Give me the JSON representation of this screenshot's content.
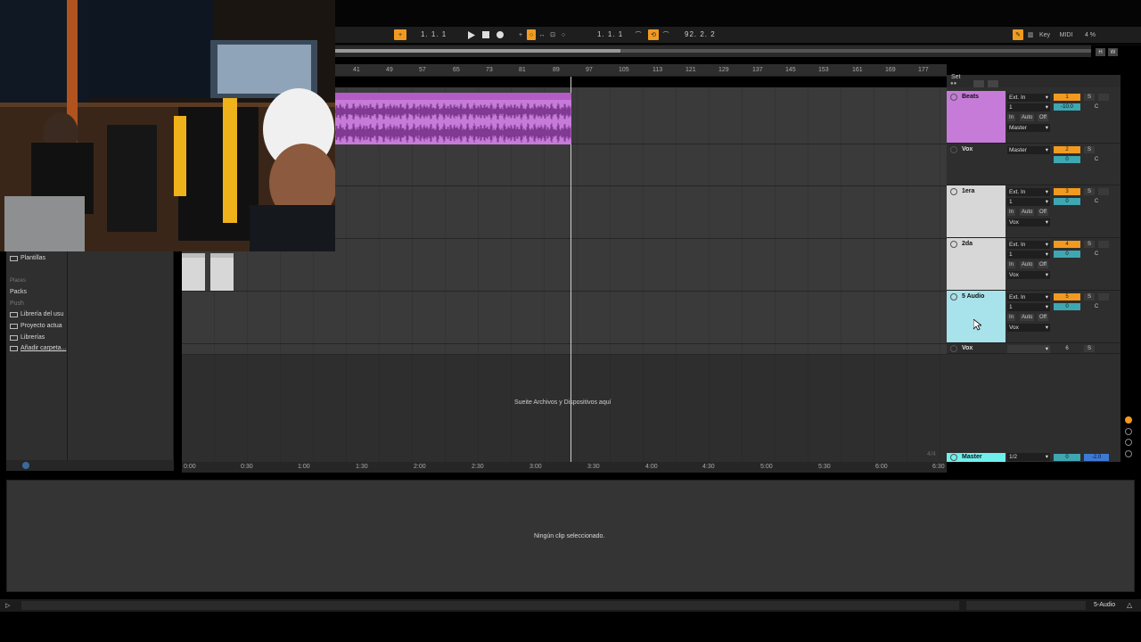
{
  "transport": {
    "position": "1.  1.  1",
    "loop_start": "1.  1.  1",
    "loop_length": "92.  2.  2",
    "key_label": "Key",
    "midi_label": "MIDI",
    "cpu": "4 %"
  },
  "overview": {
    "h_label": "H",
    "w_label": "W"
  },
  "ruler": {
    "ticks": [
      "41",
      "49",
      "57",
      "65",
      "73",
      "81",
      "89",
      "97",
      "105",
      "113",
      "121",
      "129",
      "137",
      "145",
      "153",
      "161",
      "169",
      "177"
    ]
  },
  "set_label": "Set",
  "arrangement": {
    "drop_hint": "Sueite Archivos y Dispositivos aquí",
    "time_sig": "4/4"
  },
  "time_ruler": {
    "ticks": [
      "0:00",
      "0:30",
      "1:00",
      "1:30",
      "2:00",
      "2:30",
      "3:00",
      "3:30",
      "4:00",
      "4:30",
      "5:00",
      "5:30",
      "6:00",
      "6:30"
    ]
  },
  "browser": {
    "items_top": [
      "Plantillas"
    ],
    "places_header": "Places",
    "places": [
      "Packs",
      "Push",
      "Librería del usu",
      "Proyecto actua",
      "Librerías",
      "Añadir carpeta..."
    ]
  },
  "mixer": {
    "tracks": [
      {
        "name": "Beats",
        "input": "Ext. In",
        "channel": "1",
        "output": "Master",
        "num": "1",
        "vol": "-10.0",
        "color": "#c67bd9"
      },
      {
        "name": "Vox",
        "output": "Master",
        "num": "2",
        "vol": "0",
        "color": "#2e2e2e"
      },
      {
        "name": "1era",
        "input": "Ext. In",
        "channel": "1",
        "output": "Vox",
        "num": "3",
        "vol": "0",
        "color": "#d7d7d7"
      },
      {
        "name": "2da",
        "input": "Ext. In",
        "channel": "1",
        "output": "Vox",
        "num": "4",
        "vol": "0",
        "color": "#d7d7d7"
      },
      {
        "name": "5 Audio",
        "input": "Ext. In",
        "channel": "1",
        "output": "Vox",
        "num": "5",
        "vol": "0",
        "color": "#a8e2ea"
      },
      {
        "name": "Vox",
        "num": "6",
        "color": "#2e2e2e"
      }
    ],
    "monitor": {
      "in": "In",
      "auto": "Auto",
      "off": "Off"
    },
    "solo_label": "S",
    "center_label": "C",
    "master": {
      "name": "Master",
      "output": "1/2",
      "vol": "0",
      "pan": "-2.0"
    }
  },
  "detail": {
    "empty_msg": "Ningún clip seleccionado."
  },
  "status": {
    "track_label": "5-Audio"
  },
  "colors": {
    "accent": "#f29a20",
    "beats": "#c67bd9",
    "audio5": "#a8e2ea",
    "master": "#6ff0ec",
    "volume": "#3fa7b1"
  }
}
